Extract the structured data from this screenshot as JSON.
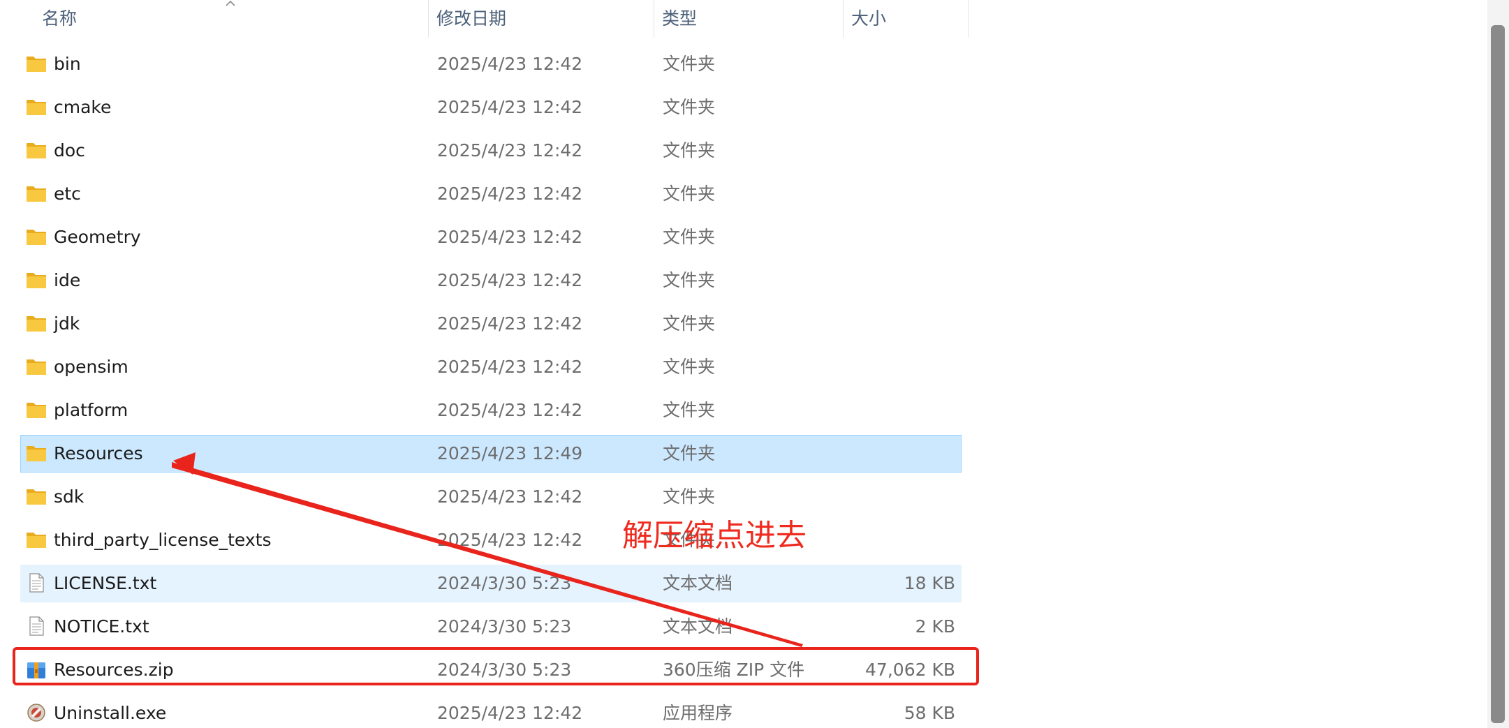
{
  "columns": {
    "name": "名称",
    "date": "修改日期",
    "type": "类型",
    "size": "大小"
  },
  "rows": [
    {
      "name": "bin",
      "date": "2025/4/23 12:42",
      "type": "文件夹",
      "size": "",
      "icon": "folder-icon",
      "state": ""
    },
    {
      "name": "cmake",
      "date": "2025/4/23 12:42",
      "type": "文件夹",
      "size": "",
      "icon": "folder-icon",
      "state": ""
    },
    {
      "name": "doc",
      "date": "2025/4/23 12:42",
      "type": "文件夹",
      "size": "",
      "icon": "folder-icon",
      "state": ""
    },
    {
      "name": "etc",
      "date": "2025/4/23 12:42",
      "type": "文件夹",
      "size": "",
      "icon": "folder-icon",
      "state": ""
    },
    {
      "name": "Geometry",
      "date": "2025/4/23 12:42",
      "type": "文件夹",
      "size": "",
      "icon": "folder-icon",
      "state": ""
    },
    {
      "name": "ide",
      "date": "2025/4/23 12:42",
      "type": "文件夹",
      "size": "",
      "icon": "folder-icon",
      "state": ""
    },
    {
      "name": "jdk",
      "date": "2025/4/23 12:42",
      "type": "文件夹",
      "size": "",
      "icon": "folder-icon",
      "state": ""
    },
    {
      "name": "opensim",
      "date": "2025/4/23 12:42",
      "type": "文件夹",
      "size": "",
      "icon": "folder-icon",
      "state": ""
    },
    {
      "name": "platform",
      "date": "2025/4/23 12:42",
      "type": "文件夹",
      "size": "",
      "icon": "folder-icon",
      "state": ""
    },
    {
      "name": "Resources",
      "date": "2025/4/23 12:49",
      "type": "文件夹",
      "size": "",
      "icon": "folder-icon",
      "state": "selected"
    },
    {
      "name": "sdk",
      "date": "2025/4/23 12:42",
      "type": "文件夹",
      "size": "",
      "icon": "folder-icon",
      "state": ""
    },
    {
      "name": "third_party_license_texts",
      "date": "2025/4/23 12:42",
      "type": "文件夹",
      "size": "",
      "icon": "folder-icon",
      "state": ""
    },
    {
      "name": "LICENSE.txt",
      "date": "2024/3/30 5:23",
      "type": "文本文档",
      "size": "18 KB",
      "icon": "text-file-icon",
      "state": "hover"
    },
    {
      "name": "NOTICE.txt",
      "date": "2024/3/30 5:23",
      "type": "文本文档",
      "size": "2 KB",
      "icon": "text-file-icon",
      "state": ""
    },
    {
      "name": "Resources.zip",
      "date": "2024/3/30 5:23",
      "type": "360压缩 ZIP 文件",
      "size": "47,062 KB",
      "icon": "zip-archive-icon",
      "state": ""
    },
    {
      "name": "Uninstall.exe",
      "date": "2025/4/23 12:42",
      "type": "应用程序",
      "size": "58 KB",
      "icon": "uninstall-app-icon",
      "state": ""
    }
  ],
  "annotation": {
    "text": "解压缩点进去",
    "color": "#e8241c"
  },
  "colors": {
    "selected_bg": "#cce8ff",
    "hover_bg": "#e5f3ff",
    "folder": "#f8c940"
  }
}
